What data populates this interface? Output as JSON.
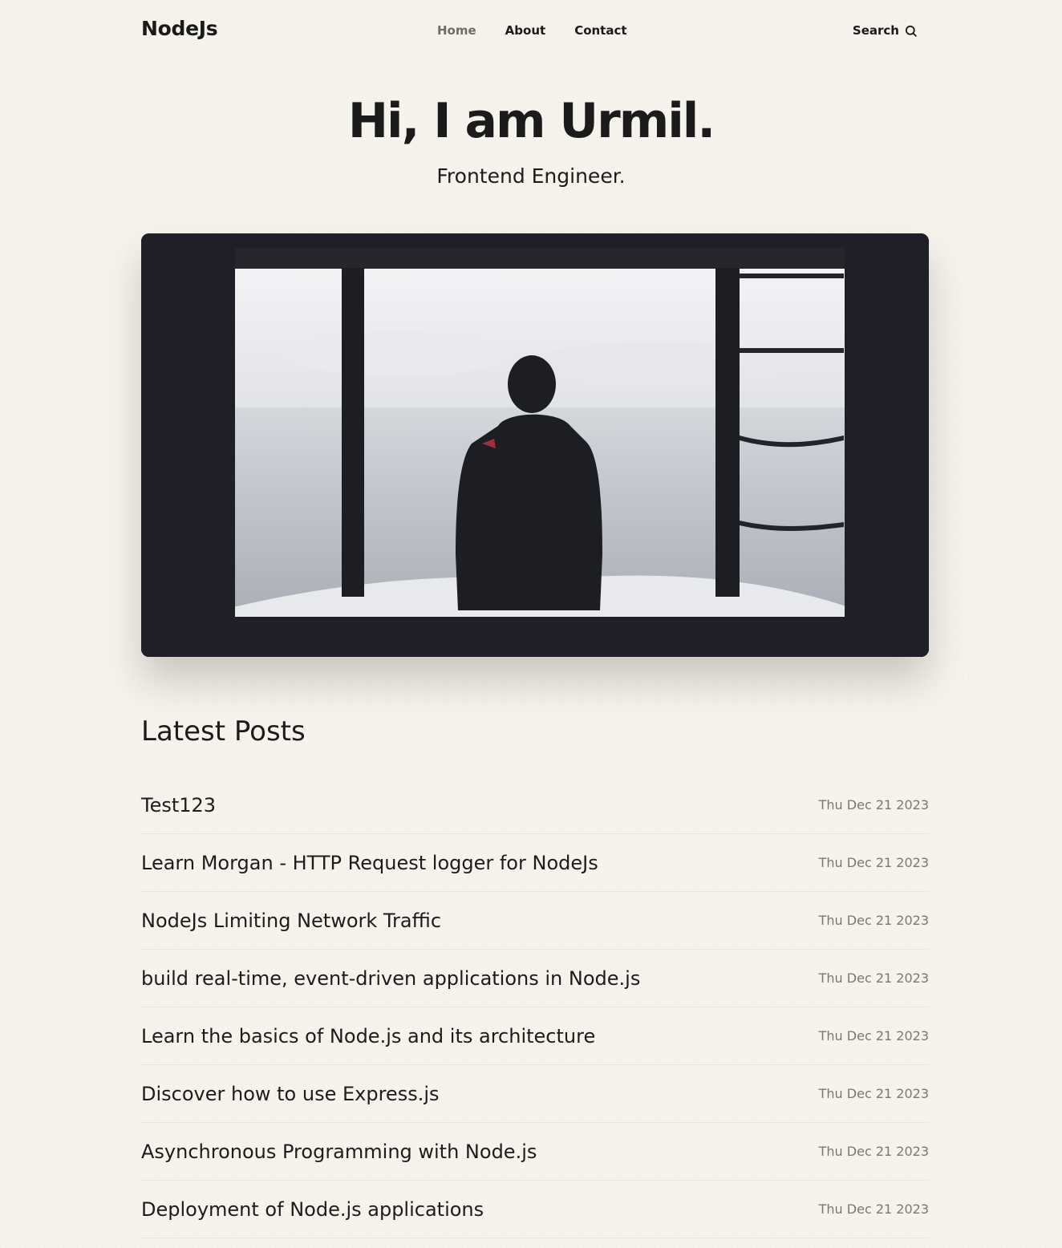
{
  "header": {
    "logo": "NodeJs",
    "nav": [
      {
        "label": "Home",
        "active": true
      },
      {
        "label": "About",
        "active": false
      },
      {
        "label": "Contact",
        "active": false
      }
    ],
    "search_label": "Search"
  },
  "hero": {
    "title": "Hi, I am Urmil.",
    "subtitle": "Frontend Engineer."
  },
  "posts_section": {
    "title": "Latest Posts",
    "posts": [
      {
        "title": "Test123",
        "date": "Thu Dec 21 2023"
      },
      {
        "title": "Learn Morgan - HTTP Request logger for NodeJs",
        "date": "Thu Dec 21 2023"
      },
      {
        "title": "NodeJs Limiting Network Traffic",
        "date": "Thu Dec 21 2023"
      },
      {
        "title": "build real-time, event-driven applications in Node.js",
        "date": "Thu Dec 21 2023"
      },
      {
        "title": "Learn the basics of Node.js and its architecture",
        "date": "Thu Dec 21 2023"
      },
      {
        "title": "Discover how to use Express.js",
        "date": "Thu Dec 21 2023"
      },
      {
        "title": "Asynchronous Programming with Node.js",
        "date": "Thu Dec 21 2023"
      },
      {
        "title": "Deployment of Node.js applications",
        "date": "Thu Dec 21 2023"
      }
    ]
  },
  "colors": {
    "background": "#f6f3ec",
    "text": "#1c1c1c",
    "nav_active": "#6f6d69",
    "date": "#7a7873",
    "image_dark": "#1f1f27"
  }
}
